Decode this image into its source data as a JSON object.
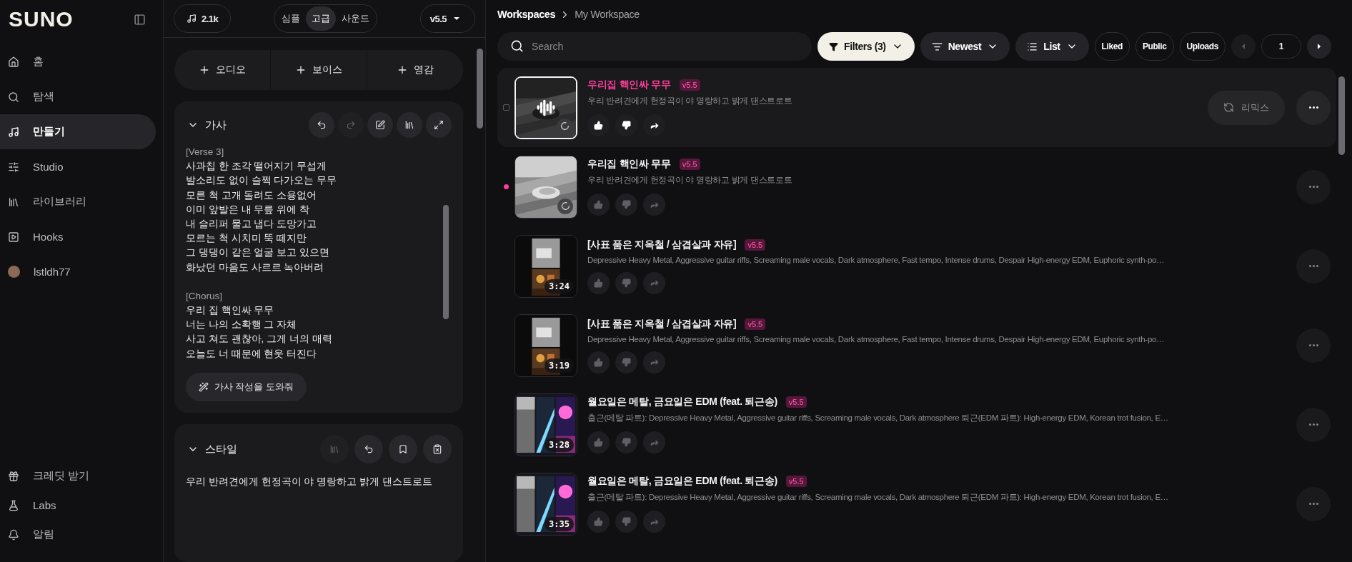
{
  "sidebar": {
    "logo": "SUNO",
    "nav": [
      {
        "label": "홈",
        "selected": false
      },
      {
        "label": "탐색",
        "selected": false
      },
      {
        "label": "만들기",
        "selected": true
      },
      {
        "label": "Studio",
        "selected": false
      },
      {
        "label": "라이브러리",
        "selected": false
      },
      {
        "label": "Hooks",
        "selected": false
      },
      {
        "label": "lstldh77",
        "selected": false
      }
    ],
    "bottom": [
      {
        "label": "크레딧 받기"
      },
      {
        "label": "Labs"
      },
      {
        "label": "알림"
      }
    ]
  },
  "composer": {
    "credits": "2.1k",
    "modes": [
      {
        "label": "심플",
        "selected": false
      },
      {
        "label": "고급",
        "selected": true
      },
      {
        "label": "사운드",
        "selected": false
      }
    ],
    "model": "v5.5",
    "add_buttons": [
      "오디오",
      "보이스",
      "영감"
    ],
    "lyrics": {
      "title": "가사",
      "expanded": true,
      "tools": [
        {
          "disabled": false
        },
        {
          "disabled": true
        },
        {
          "disabled": false
        },
        {
          "disabled": false
        },
        {
          "disabled": false
        }
      ],
      "sections": [
        {
          "header": "[Verse 3]",
          "lines": [
            "사과칩 한 조각 떨어지기 무섭게",
            "발소리도 없이 슬쩍 다가오는 무무",
            "모른 척 고개 돌려도 소용없어",
            "이미 앞발은 내 무릎 위에 착",
            "내 슬리퍼 물고 냅다 도망가고",
            "모르는 척 시치미 뚝 떼지만",
            "그 댕댕이 같은 얼굴 보고 있으면",
            "화났던 마음도 사르르 녹아버려"
          ]
        },
        {
          "header": "[Chorus]",
          "lines": [
            "우리 집 핵인싸 무무",
            "너는 나의 소확행 그 자체",
            "사고 쳐도 괜찮아, 그게 너의 매력",
            "오늘도 너 때문에 현웃 터진다"
          ]
        }
      ],
      "helper_button": "가사 작성을 도와줘"
    },
    "style": {
      "title": "스타일",
      "expanded": true,
      "tools": [
        {
          "disabled": true
        },
        {
          "disabled": false
        },
        {
          "disabled": false
        },
        {
          "disabled": false
        }
      ],
      "value": "우리 반려견에게 헌정곡이 야 명랑하고 밝게 댄스트로트"
    }
  },
  "workspace": {
    "breadcrumb": [
      "Workspaces",
      "My Workspace"
    ],
    "search": {
      "placeholder": "Search"
    },
    "filters": "Filters (3)",
    "sort": "Newest",
    "view": "List",
    "toggles": [
      "Liked",
      "Public",
      "Uploads"
    ],
    "page": "1",
    "prev_disabled": true,
    "songs": [
      {
        "title": "우리집 핵인싸 무무",
        "version": "v5.5",
        "description": "우리 반려견에게 헌정곡이 야 명랑하고 밝게 댄스트로트",
        "playing": true,
        "processing": true,
        "new": false,
        "hovered": true,
        "remix_label": "리믹스"
      },
      {
        "title": "우리집 핵인싸 무무",
        "version": "v5.5",
        "description": "우리 반려견에게 헌정곡이 야 명랑하고 밝게 댄스트로트",
        "playing": false,
        "processing": true,
        "new": true,
        "hovered": false
      },
      {
        "title": "[사표 품은 지옥철 / 삼겹살과 자유]",
        "version": "v5.5",
        "description": "Depressive Heavy Metal, Aggressive guitar riffs, Screaming male vocals, Dark atmosphere, Fast tempo, Intense drums, Despair High-energy EDM, Euphoric synth-po…",
        "duration": "3:24",
        "playing": false,
        "processing": false,
        "new": false,
        "hovered": false
      },
      {
        "title": "[사표 품은 지옥철 / 삼겹살과 자유]",
        "version": "v5.5",
        "description": "Depressive Heavy Metal, Aggressive guitar riffs, Screaming male vocals, Dark atmosphere, Fast tempo, Intense drums, Despair High-energy EDM, Euphoric synth-po…",
        "duration": "3:19",
        "playing": false,
        "processing": false,
        "new": false,
        "hovered": false
      },
      {
        "title": "월요일은 메탈, 금요일은 EDM (feat. 퇴근송)",
        "version": "v5.5",
        "description": "출근(메탈 파트): Depressive Heavy Metal, Aggressive guitar riffs, Screaming male vocals, Dark atmosphere 퇴근(EDM 파트): High-energy EDM, Korean trot fusion, E…",
        "duration": "3:28",
        "playing": false,
        "processing": false,
        "new": false,
        "hovered": false
      },
      {
        "title": "월요일은 메탈, 금요일은 EDM (feat. 퇴근송)",
        "version": "v5.5",
        "description": "출근(메탈 파트): Depressive Heavy Metal, Aggressive guitar riffs, Screaming male vocals, Dark atmosphere 퇴근(EDM 파트): High-energy EDM, Korean trot fusion, E…",
        "duration": "3:35",
        "playing": false,
        "processing": false,
        "new": false,
        "hovered": false
      }
    ]
  }
}
